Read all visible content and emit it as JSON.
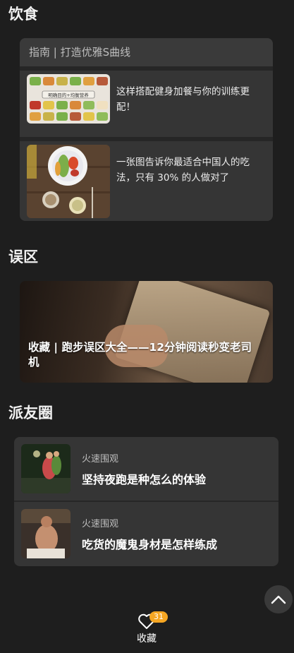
{
  "sections": {
    "diet": "饮食",
    "mistakes": "误区",
    "friends": "派友圈"
  },
  "diet": {
    "header": "指南 | 打造优雅S曲线",
    "items": [
      {
        "text": "这样搭配健身加餐与你的训练更配！",
        "image_caption": "明确目的+均衡营养"
      },
      {
        "text": "一张图告诉你最适合中国人的吃法，只有 30% 的人做对了"
      }
    ]
  },
  "banner": {
    "title": "收藏 | 跑步误区大全——12分钟阅读秒变老司机"
  },
  "friends": {
    "items": [
      {
        "source": "火速围观",
        "title": "坚持夜跑是种怎么的体验"
      },
      {
        "source": "火速围观",
        "title": "吃货的魔鬼身材是怎样练成"
      }
    ]
  },
  "favorite": {
    "label": "收藏",
    "count": "31"
  },
  "icons": [
    "heart-icon",
    "chevron-up-icon"
  ],
  "colors": {
    "background": "#1e1e1e",
    "card": "#353535",
    "badge": "#f5a623"
  }
}
